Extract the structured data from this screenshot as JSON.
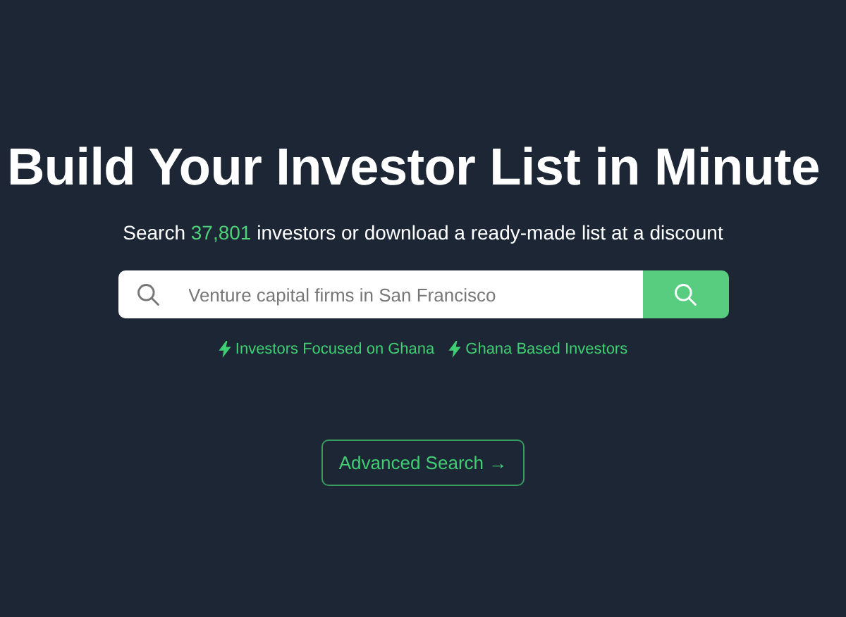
{
  "headline": "Build Your Investor List in Minute",
  "subtitle": {
    "before": "Search",
    "count": "37,801",
    "after": "investors or download a ready-made list at a discount"
  },
  "search": {
    "placeholder": "Venture capital firms in San Francisco"
  },
  "quick_links": [
    {
      "label": "Investors Focused on Ghana"
    },
    {
      "label": "Ghana Based Investors"
    }
  ],
  "advanced_button": "Advanced Search →"
}
